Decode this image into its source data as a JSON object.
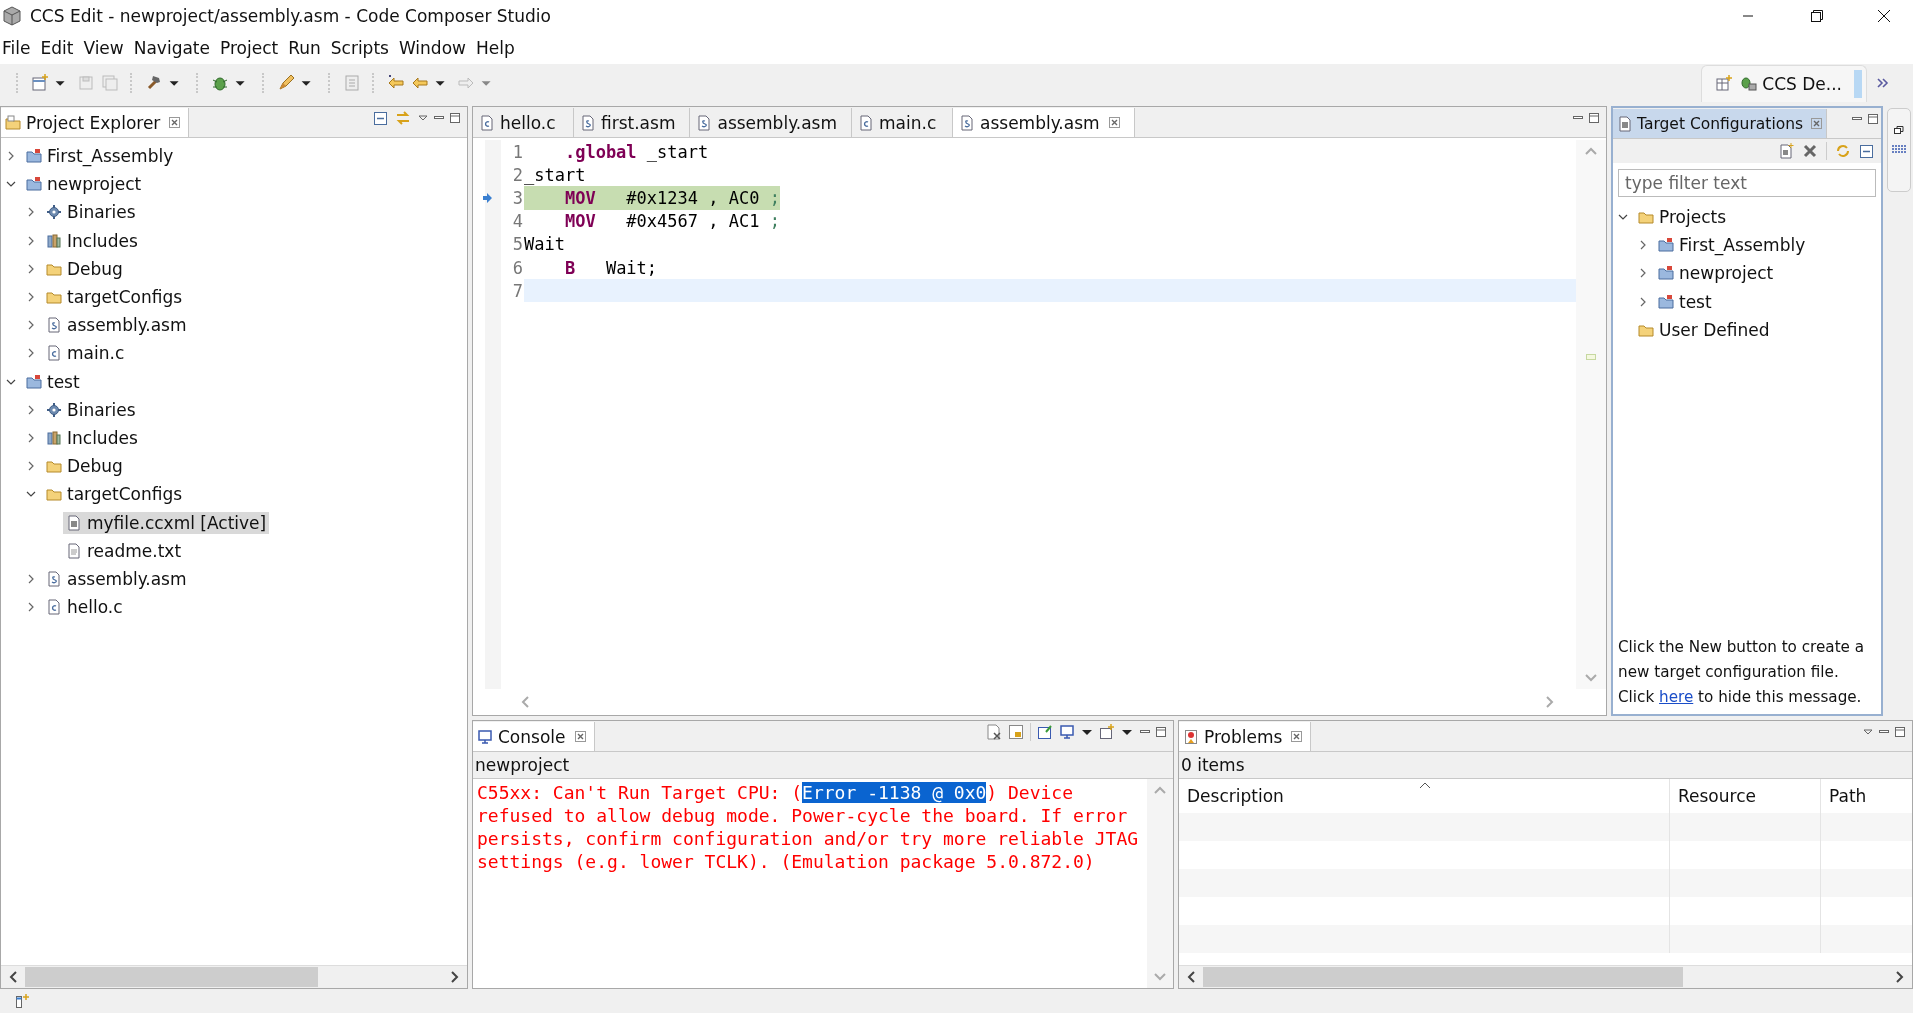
{
  "window": {
    "title": "CCS Edit - newproject/assembly.asm - Code Composer Studio"
  },
  "menu": [
    "File",
    "Edit",
    "View",
    "Navigate",
    "Project",
    "Run",
    "Scripts",
    "Window",
    "Help"
  ],
  "perspective": {
    "label": "CCS De..."
  },
  "project_explorer": {
    "title": "Project Explorer",
    "tree": [
      {
        "label": "First_Assembly",
        "kind": "project",
        "expanded": false,
        "selected": false
      },
      {
        "label": "newproject",
        "kind": "project",
        "expanded": true,
        "selected": false,
        "children": [
          {
            "label": "Binaries",
            "kind": "binaries",
            "expanded": false,
            "selected": false
          },
          {
            "label": "Includes",
            "kind": "includes",
            "expanded": false,
            "selected": false
          },
          {
            "label": "Debug",
            "kind": "folder",
            "expanded": false,
            "selected": false
          },
          {
            "label": "targetConfigs",
            "kind": "folder",
            "expanded": false,
            "selected": false
          },
          {
            "label": "assembly.asm",
            "kind": "asm",
            "expanded": false,
            "selected": false
          },
          {
            "label": "main.c",
            "kind": "c",
            "expanded": false,
            "selected": false
          }
        ]
      },
      {
        "label": "test",
        "kind": "project",
        "expanded": true,
        "selected": false,
        "children": [
          {
            "label": "Binaries",
            "kind": "binaries",
            "expanded": false,
            "selected": false
          },
          {
            "label": "Includes",
            "kind": "includes",
            "expanded": false,
            "selected": false
          },
          {
            "label": "Debug",
            "kind": "folder",
            "expanded": false,
            "selected": false
          },
          {
            "label": "targetConfigs",
            "kind": "folder",
            "expanded": true,
            "selected": false,
            "children": [
              {
                "label": "myfile.ccxml [Active]",
                "kind": "ccxml",
                "selected": true
              },
              {
                "label": "readme.txt",
                "kind": "txt",
                "selected": false
              }
            ]
          },
          {
            "label": "assembly.asm",
            "kind": "asm",
            "expanded": false,
            "selected": false
          },
          {
            "label": "hello.c",
            "kind": "c",
            "expanded": false,
            "selected": false
          }
        ]
      }
    ]
  },
  "editor": {
    "tabs": [
      {
        "label": "hello.c",
        "kind": "c",
        "selected": false
      },
      {
        "label": "first.asm",
        "kind": "asm",
        "selected": false
      },
      {
        "label": "assembly.asm",
        "kind": "asm",
        "selected": false
      },
      {
        "label": "main.c",
        "kind": "c",
        "selected": false
      },
      {
        "label": "assembly.asm",
        "kind": "asm",
        "selected": true
      }
    ],
    "lines": [
      {
        "number": "1",
        "indented": true,
        "tokens": [
          {
            "kind": "directive",
            "text": ".global"
          },
          {
            "kind": "text",
            "text": " _start"
          }
        ],
        "current_pc": false,
        "cursor": false
      },
      {
        "number": "2",
        "indented": false,
        "tokens": [
          {
            "kind": "text",
            "text": "_start"
          }
        ],
        "current_pc": false,
        "cursor": false
      },
      {
        "number": "3",
        "indented": true,
        "tokens": [
          {
            "kind": "keyword",
            "text": "MOV"
          },
          {
            "kind": "text",
            "text": "   #0x1234 , AC0 "
          },
          {
            "kind": "comment",
            "text": ";"
          }
        ],
        "current_pc": true,
        "cursor": false
      },
      {
        "number": "4",
        "indented": true,
        "tokens": [
          {
            "kind": "keyword",
            "text": "MOV"
          },
          {
            "kind": "text",
            "text": "   #0x4567 , AC1 "
          },
          {
            "kind": "comment",
            "text": ";"
          }
        ],
        "current_pc": false,
        "cursor": false
      },
      {
        "number": "5",
        "indented": false,
        "tokens": [
          {
            "kind": "text",
            "text": "Wait"
          }
        ],
        "current_pc": false,
        "cursor": false
      },
      {
        "number": "6",
        "indented": true,
        "tokens": [
          {
            "kind": "keyword",
            "text": "B"
          },
          {
            "kind": "text",
            "text": "   Wait;"
          }
        ],
        "current_pc": false,
        "cursor": false
      },
      {
        "number": "7",
        "indented": false,
        "current_pc": false,
        "cursor": true
      }
    ]
  },
  "target_configurations": {
    "title": "Target Configurations",
    "filter": {
      "placeholder": "type filter text"
    },
    "tree": [
      {
        "label": "Projects",
        "kind": "folder",
        "expanded": true,
        "children": [
          {
            "label": "First_Assembly",
            "kind": "project",
            "expanded": false
          },
          {
            "label": "newproject",
            "kind": "project",
            "expanded": false
          },
          {
            "label": "test",
            "kind": "project",
            "expanded": false
          }
        ]
      },
      {
        "label": "User Defined",
        "kind": "folder"
      }
    ],
    "message": {
      "before": "Click the New button to create a new target configuration file. Click ",
      "link": "here",
      "after": " to hide this message."
    }
  },
  "console": {
    "title": "Console",
    "source": "newproject",
    "message": {
      "before": "C55xx: Can't Run Target CPU: (",
      "selected": "Error -1138 @ 0x0",
      "after": ") Device refused to allow debug mode. Power-cycle the board. If error persists, confirm configuration and/or try more reliable JTAG settings (e.g. lower TCLK). (Emulation package 5.0.872.0)"
    }
  },
  "problems": {
    "title": "Problems",
    "summary": "0 items",
    "columns": [
      "Description",
      "Resource",
      "Path"
    ]
  }
}
